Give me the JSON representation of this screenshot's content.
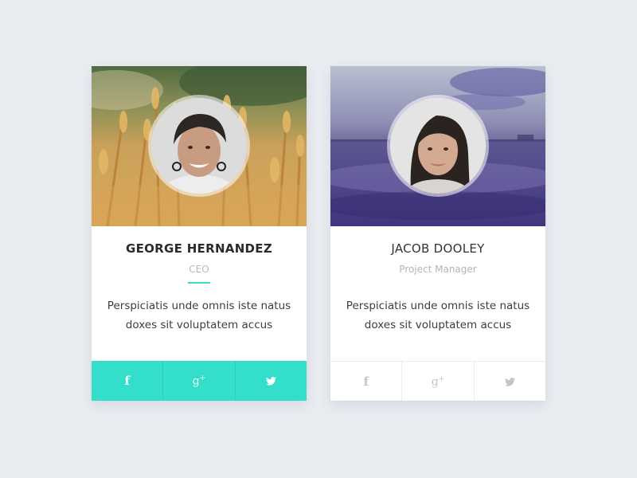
{
  "cards": [
    {
      "name": "GEORGE HERNANDEZ",
      "role": "CEO",
      "bio": "Perspiciatis unde omnis iste natus doxes sit voluptatem accus",
      "cover": "wheat-field",
      "accent": "#33dfca",
      "social": [
        "facebook-icon",
        "google-plus-icon",
        "twitter-icon"
      ],
      "social_state": "active"
    },
    {
      "name": "JACOB DOOLEY",
      "role": "Project Manager",
      "bio": "Perspiciatis unde omnis iste natus doxes sit voluptatem accus",
      "cover": "purple-lake",
      "social": [
        "facebook-icon",
        "google-plus-icon",
        "twitter-icon"
      ],
      "social_state": "muted"
    }
  ],
  "colors": {
    "background": "#e9ecf1",
    "accent": "#33dfca",
    "muted_icon": "#c4c4c4"
  }
}
